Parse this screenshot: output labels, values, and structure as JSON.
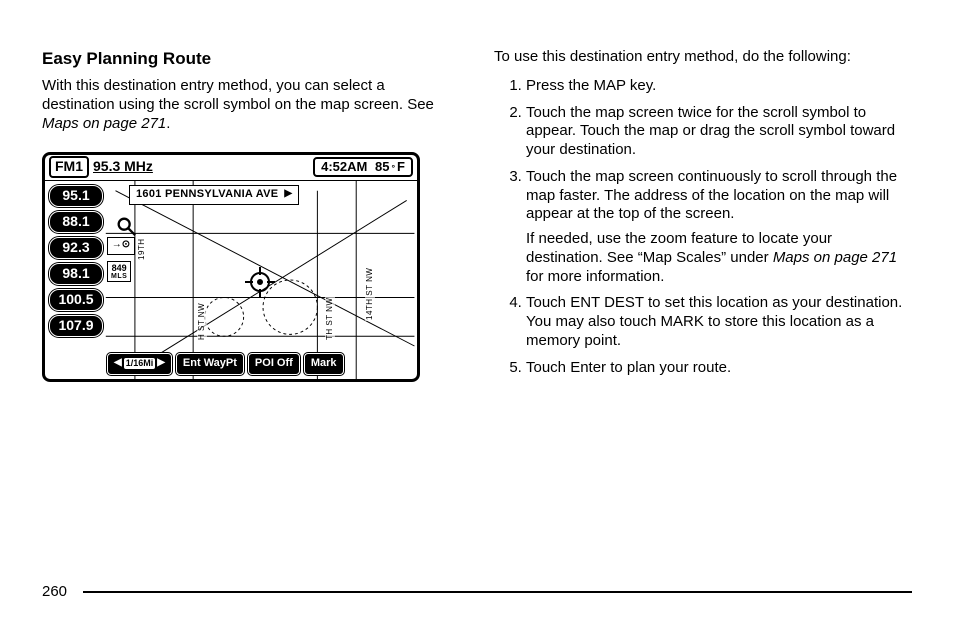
{
  "heading": "Easy Planning Route",
  "intro_a": "With this destination entry method, you can select a destination using the scroll symbol on the map screen. See ",
  "intro_ref": "Maps on page 271",
  "intro_b": ".",
  "right_lead": "To use this destination entry method, do the following:",
  "steps": {
    "s1": "Press the MAP key.",
    "s2": "Touch the map screen twice for the scroll symbol to appear. Touch the map or drag the scroll symbol toward your destination.",
    "s3": "Touch the map screen continuously to scroll through the map faster. The address of the location on the map will appear at the top of the screen.",
    "s3b_a": "If needed, use the zoom feature to locate your destination. See “Map Scales” under ",
    "s3b_ref": "Maps on page 271",
    "s3b_b": " for more information.",
    "s4": "Touch ENT DEST to set this location as your destination. You may also touch MARK to store this location as a memory point.",
    "s5": "Touch Enter to plan your route."
  },
  "nav": {
    "band": "FM1",
    "freq": "95.3 MHz",
    "time": "4:52AM",
    "temp": "85",
    "temp_unit": "F",
    "address": "1601 PENNSYLVANIA AVE",
    "presets": [
      "95.1",
      "88.1",
      "92.3",
      "98.1",
      "100.5",
      "107.9"
    ],
    "scale_value": "849",
    "scale_unit": "MLS",
    "zoom_label": "1/16Mi",
    "streets": {
      "a": "19TH",
      "b": "H ST NW",
      "c": "TH ST NW",
      "d": "14TH ST NW"
    },
    "bottom": {
      "entwaypt": "Ent WayPt",
      "poi": "POI Off",
      "mark": "Mark"
    }
  },
  "page_number": "260"
}
